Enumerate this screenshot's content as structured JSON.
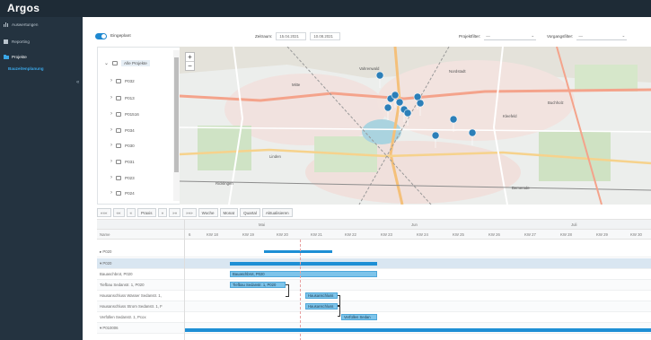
{
  "app": {
    "title": "Argos"
  },
  "sidebar": {
    "items": [
      {
        "label": "Auswertungen",
        "icon": "bar-chart-icon",
        "selected": false
      },
      {
        "label": "Reporting",
        "icon": "report-icon",
        "selected": false
      },
      {
        "label": "Projekte",
        "icon": "folder-icon",
        "selected": true
      },
      {
        "label": "Bauzeitenplanung",
        "icon": "",
        "sub": true
      }
    ],
    "collapse_icon": "double-chevron-left-icon"
  },
  "toolbar": {
    "toggle_label": "Eingeplant",
    "zeitraum_label": "Zeitraum:",
    "date_from": "15.04.2021",
    "date_to": "10.08.2021",
    "projektfilter_label": "Projektfilter:",
    "projektfilter_value": "—",
    "vorgangsfilter_label": "Vorgangsfilter:",
    "vorgangsfilter_value": "—"
  },
  "tree": {
    "root": "Alle Projekte",
    "items": [
      "P032",
      "P013",
      "P01516",
      "P034",
      "P030",
      "P031",
      "P023",
      "P024"
    ]
  },
  "map": {
    "zoom_in": "+",
    "zoom_out": "−",
    "pin_color": "#2c7fb8",
    "labels": [
      "Mitte",
      "Nordstadt",
      "Linden",
      "Buchholz",
      "Kleefeld",
      "Bemerode",
      "Ricklingen",
      "Vahrenwald"
    ]
  },
  "gantt_toolbar": {
    "buttons": [
      "«««",
      "««",
      "«",
      "Praxis",
      "»",
      "»»",
      "»»»"
    ],
    "views": [
      "Woche",
      "Monat",
      "Quartal",
      "Aktualisieren"
    ]
  },
  "gantt": {
    "name_header": "Name",
    "months": [
      "Mai",
      "Jun",
      "Juli"
    ],
    "weeks": [
      "6",
      "KW 18",
      "KW 19",
      "KW 20",
      "KW 21",
      "KW 22",
      "KW 23",
      "KW 24",
      "KW 25",
      "KW 26",
      "KW 27",
      "KW 28",
      "KW 29",
      "KW 30"
    ],
    "rows": [
      "▸ P020",
      "▾ P020",
      "Bauaschbrot, P020",
      "Tiefbau Sedanstr. 1, P020",
      "Hausanschluss Wasser Sedanstr. 1,",
      "Hausanschluss Strom Sedanstr. 1, F",
      "Verfüllen Sedanstr. 1, Pcox",
      "▾ P010006"
    ],
    "bars": [
      "Bauaschbrot, P020",
      "Tiefbau Sedanstr. 1, P020",
      "Hausanschluss",
      "Hausanschluss",
      "Verfüllen Sedan"
    ]
  }
}
